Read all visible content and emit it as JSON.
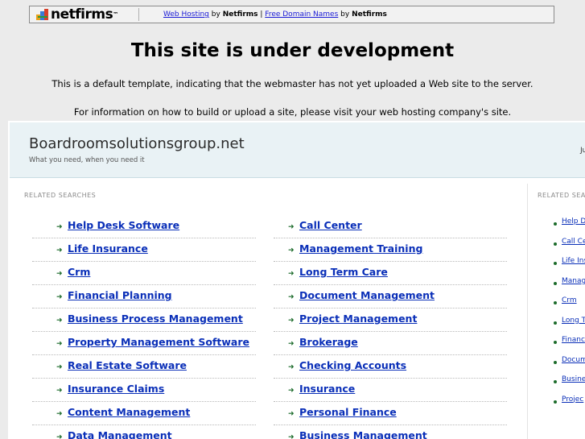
{
  "topbar": {
    "logo_text": "netfirms",
    "promo": {
      "link1": "Web Hosting",
      "by1": "by",
      "brand1": "Netfirms",
      "pipe": "|",
      "link2": "Free Domain Names",
      "by2": "by",
      "brand2": "Netfirms"
    }
  },
  "notice": {
    "title": "This site is under development",
    "line1": "This is a default template, indicating that the webmaster has not yet uploaded a Web site to the server.",
    "line2": "For information on how to build or upload a site, please visit your web hosting company's site."
  },
  "parked": {
    "domain": "Boardroomsolutionsgroup.net",
    "tagline": "What you need, when you need it",
    "date_fragment": "Ju",
    "related_label": "RELATED SEARCHES",
    "related_label_right": "RELATED SEA",
    "left_links": [
      "Help Desk Software",
      "Life Insurance",
      "Crm",
      "Financial Planning",
      "Business Process Management",
      "Property Management Software",
      "Real Estate Software",
      "Insurance Claims",
      "Content Management",
      "Data Management"
    ],
    "right_links": [
      "Call Center",
      "Management Training",
      "Long Term Care",
      "Document Management",
      "Project Management",
      "Brokerage",
      "Checking Accounts",
      "Insurance",
      "Personal Finance",
      "Business Management"
    ],
    "side_links": [
      "Help D",
      "Call Ce",
      "Life Ins",
      "Manag",
      "Crm",
      "Long T",
      "Financ",
      "Docum",
      "Busine",
      "Projec"
    ]
  },
  "colors": {
    "link": "#0a2fb8",
    "arrow": "#1b6b2a",
    "header_bg": "#e9f2f5"
  }
}
